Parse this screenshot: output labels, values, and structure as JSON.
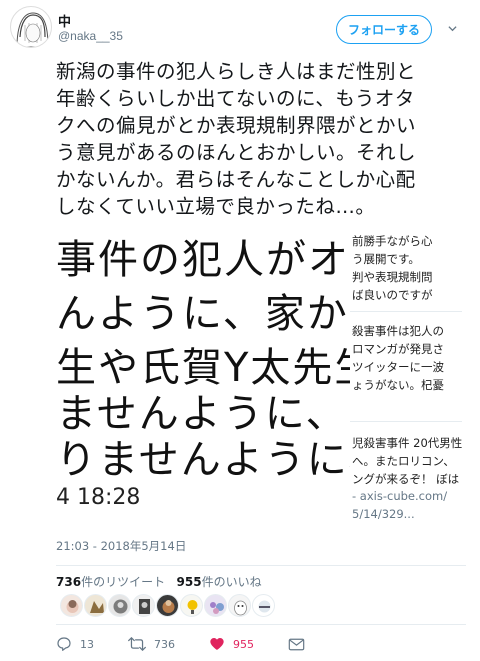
{
  "header": {
    "name": "中",
    "handle": "@naka__35",
    "follow_label": "フォローする"
  },
  "tweet": {
    "lines": [
      "新潟の事件の犯人らしき人はまだ性別と",
      "年齢くらいしか出てないのに、もうオタ",
      "クへの偏見がとか表現規制界隈がとかい",
      "う意見があるのほんとおかしい。それし",
      "かないんか。君らはそんなことしか心配",
      "しなくていい立場で良かったね…。"
    ]
  },
  "media": {
    "big_lines": [
      "事件の犯人がオタク",
      "んように、家からク",
      "生や氏賀Y太先生の本",
      "ませんように、フォロ",
      "りませんように、"
    ],
    "big_time": "4 18:28",
    "right_lines": [
      "前勝手ながら心",
      "う展開です。",
      "判や表現規制問",
      "ば良いのですが",
      "殺害事件は犯人の",
      "ロマンガが発見さ",
      "ツイッターに一波",
      "ょうがない。杞憂",
      "児殺害事件 20代男性",
      "へ。またロリコン、",
      "ングが来るぞ！ ぼは",
      "- axis-cube.com/",
      "5/14/329..."
    ]
  },
  "timestamp": "21:03 - 2018年5月14日",
  "stats": {
    "retweets_count": "736",
    "retweets_label": "件のリツイート",
    "likes_count": "955",
    "likes_label": "件のいいね"
  },
  "actions": {
    "replies": "13",
    "retweets": "736",
    "likes": "955"
  },
  "colors": {
    "accent": "#1da1f2",
    "like": "#e0245e",
    "muted": "#657786"
  }
}
